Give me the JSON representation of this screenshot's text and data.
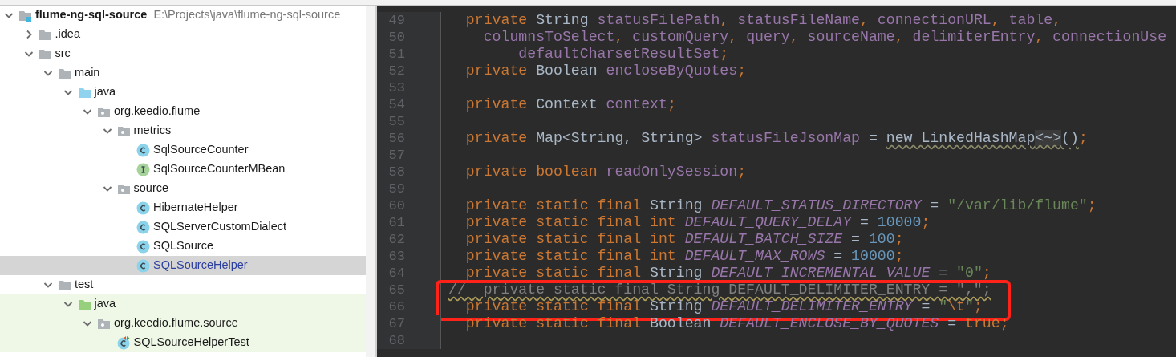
{
  "project_tree": {
    "root": {
      "label": "flume-ng-sql-source",
      "path": "E:\\Projects\\java\\flume-ng-sql-source",
      "kind": "module",
      "expanded": true,
      "selected": false,
      "children": [
        {
          "label": ".idea",
          "kind": "folder",
          "expanded": false,
          "selected": false
        },
        {
          "label": "src",
          "kind": "folder",
          "expanded": true,
          "selected": false,
          "children": [
            {
              "label": "main",
              "kind": "folder",
              "expanded": true,
              "selected": false,
              "children": [
                {
                  "label": "java",
                  "kind": "source-root",
                  "expanded": true,
                  "selected": false,
                  "children": [
                    {
                      "label": "org.keedio.flume",
                      "kind": "package",
                      "expanded": true,
                      "selected": false,
                      "children": [
                        {
                          "label": "metrics",
                          "kind": "package",
                          "expanded": true,
                          "selected": false,
                          "children": [
                            {
                              "label": "SqlSourceCounter",
                              "kind": "class",
                              "selected": false
                            },
                            {
                              "label": "SqlSourceCounterMBean",
                              "kind": "interface",
                              "selected": false
                            }
                          ]
                        },
                        {
                          "label": "source",
                          "kind": "package",
                          "expanded": true,
                          "selected": false,
                          "children": [
                            {
                              "label": "HibernateHelper",
                              "kind": "class",
                              "selected": false
                            },
                            {
                              "label": "SQLServerCustomDialect",
                              "kind": "class",
                              "selected": false
                            },
                            {
                              "label": "SQLSource",
                              "kind": "class",
                              "selected": false
                            },
                            {
                              "label": "SQLSourceHelper",
                              "kind": "class",
                              "selected": true
                            }
                          ]
                        }
                      ]
                    }
                  ]
                }
              ]
            },
            {
              "label": "test",
              "kind": "folder",
              "expanded": true,
              "selected": false,
              "children": [
                {
                  "label": "java",
                  "kind": "test-root",
                  "expanded": true,
                  "selected": false,
                  "children": [
                    {
                      "label": "org.keedio.flume.source",
                      "kind": "package",
                      "expanded": true,
                      "selected": false,
                      "children": [
                        {
                          "label": "SQLSourceHelperTest",
                          "kind": "test-class",
                          "selected": false
                        }
                      ]
                    }
                  ]
                }
              ]
            }
          ]
        }
      ]
    }
  },
  "editor": {
    "lines": [
      {
        "number": "49",
        "tokens": [
          {
            "kind": "keyword",
            "text": "  private "
          },
          {
            "kind": "type",
            "text": "String "
          },
          {
            "kind": "field",
            "text": "statusFilePath"
          },
          {
            "kind": "punct",
            "text": ", "
          },
          {
            "kind": "field",
            "text": "statusFileName"
          },
          {
            "kind": "punct",
            "text": ", "
          },
          {
            "kind": "field",
            "text": "connectionURL"
          },
          {
            "kind": "punct",
            "text": ", "
          },
          {
            "kind": "field",
            "text": "table"
          },
          {
            "kind": "punct",
            "text": ","
          }
        ]
      },
      {
        "number": "50",
        "tokens": [
          {
            "kind": "field",
            "text": "    columnsToSelect"
          },
          {
            "kind": "punct",
            "text": ", "
          },
          {
            "kind": "field",
            "text": "customQuery"
          },
          {
            "kind": "punct",
            "text": ", "
          },
          {
            "kind": "field",
            "text": "query"
          },
          {
            "kind": "punct",
            "text": ", "
          },
          {
            "kind": "field",
            "text": "sourceName"
          },
          {
            "kind": "punct",
            "text": ", "
          },
          {
            "kind": "field",
            "text": "delimiterEntry"
          },
          {
            "kind": "punct",
            "text": ", "
          },
          {
            "kind": "field",
            "text": "connectionUse"
          }
        ]
      },
      {
        "number": "51",
        "tokens": [
          {
            "kind": "field",
            "text": "        defaultCharsetResultSet"
          },
          {
            "kind": "punct",
            "text": ";"
          }
        ]
      },
      {
        "number": "52",
        "tokens": [
          {
            "kind": "keyword",
            "text": "  private "
          },
          {
            "kind": "type",
            "text": "Boolean "
          },
          {
            "kind": "field",
            "text": "encloseByQuotes"
          },
          {
            "kind": "punct",
            "text": ";"
          }
        ]
      },
      {
        "number": "53"
      },
      {
        "number": "54",
        "tokens": [
          {
            "kind": "keyword",
            "text": "  private "
          },
          {
            "kind": "type",
            "text": "Context "
          },
          {
            "kind": "field",
            "text": "context"
          },
          {
            "kind": "punct",
            "text": ";"
          }
        ]
      },
      {
        "number": "55"
      },
      {
        "number": "56",
        "tokens": [
          {
            "kind": "keyword",
            "text": "  private "
          },
          {
            "kind": "type",
            "text": "Map<String, String> "
          },
          {
            "kind": "field",
            "text": "statusFileJsonMap"
          },
          {
            "kind": "plain",
            "text": " = "
          },
          {
            "kind": "warned",
            "text": "new LinkedHashMap"
          },
          {
            "kind": "folded",
            "text": "<~>"
          },
          {
            "kind": "warned",
            "text": "()"
          },
          {
            "kind": "punct",
            "text": ";"
          }
        ]
      },
      {
        "number": "57"
      },
      {
        "number": "58",
        "tokens": [
          {
            "kind": "keyword",
            "text": "  private boolean "
          },
          {
            "kind": "field",
            "text": "readOnlySession"
          },
          {
            "kind": "punct",
            "text": ";"
          }
        ]
      },
      {
        "number": "59"
      },
      {
        "number": "60",
        "tokens": [
          {
            "kind": "keyword",
            "text": "  private static final "
          },
          {
            "kind": "type",
            "text": "String "
          },
          {
            "kind": "const",
            "text": "DEFAULT_STATUS_DIRECTORY"
          },
          {
            "kind": "plain",
            "text": " = "
          },
          {
            "kind": "string",
            "text": "\"/var/lib/flume\""
          },
          {
            "kind": "punct",
            "text": ";"
          }
        ]
      },
      {
        "number": "61",
        "tokens": [
          {
            "kind": "keyword",
            "text": "  private static final int "
          },
          {
            "kind": "const",
            "text": "DEFAULT_QUERY_DELAY"
          },
          {
            "kind": "plain",
            "text": " = "
          },
          {
            "kind": "number",
            "text": "10000"
          },
          {
            "kind": "punct",
            "text": ";"
          }
        ]
      },
      {
        "number": "62",
        "tokens": [
          {
            "kind": "keyword",
            "text": "  private static final int "
          },
          {
            "kind": "const",
            "text": "DEFAULT_BATCH_SIZE"
          },
          {
            "kind": "plain",
            "text": " = "
          },
          {
            "kind": "number",
            "text": "100"
          },
          {
            "kind": "punct",
            "text": ";"
          }
        ]
      },
      {
        "number": "63",
        "tokens": [
          {
            "kind": "keyword",
            "text": "  private static final int "
          },
          {
            "kind": "const",
            "text": "DEFAULT_MAX_ROWS"
          },
          {
            "kind": "plain",
            "text": " = "
          },
          {
            "kind": "number",
            "text": "10000"
          },
          {
            "kind": "punct",
            "text": ";"
          }
        ]
      },
      {
        "number": "64",
        "tokens": [
          {
            "kind": "keyword",
            "text": "  private static final "
          },
          {
            "kind": "type",
            "text": "String "
          },
          {
            "kind": "const",
            "text": "DEFAULT_INCREMENTAL_VALUE"
          },
          {
            "kind": "plain",
            "text": " = "
          },
          {
            "kind": "string",
            "text": "\"0\""
          },
          {
            "kind": "punct",
            "text": ";"
          }
        ]
      },
      {
        "number": "65",
        "highlighted": true,
        "tokens": [
          {
            "kind": "warned-comment",
            "text": "//  private static final String DEFAULT_DELIMITER_ENTRY = \",\";"
          }
        ]
      },
      {
        "number": "66",
        "highlighted": true,
        "tokens": [
          {
            "kind": "keyword",
            "text": "  private static final "
          },
          {
            "kind": "type",
            "text": "String "
          },
          {
            "kind": "const",
            "text": "DEFAULT_DELIMITER_ENTRY"
          },
          {
            "kind": "plain",
            "text": " = "
          },
          {
            "kind": "string",
            "text": "\""
          },
          {
            "kind": "escape",
            "text": "\\t"
          },
          {
            "kind": "string",
            "text": "\""
          },
          {
            "kind": "punct",
            "text": ";"
          }
        ]
      },
      {
        "number": "67",
        "tokens": [
          {
            "kind": "keyword",
            "text": "  private static final "
          },
          {
            "kind": "type",
            "text": "Boolean "
          },
          {
            "kind": "const",
            "text": "DEFAULT_ENCLOSE_BY_QUOTES"
          },
          {
            "kind": "plain",
            "text": " = "
          },
          {
            "kind": "keyword",
            "text": "true"
          },
          {
            "kind": "punct",
            "text": ";"
          }
        ]
      },
      {
        "number": "68"
      }
    ]
  }
}
